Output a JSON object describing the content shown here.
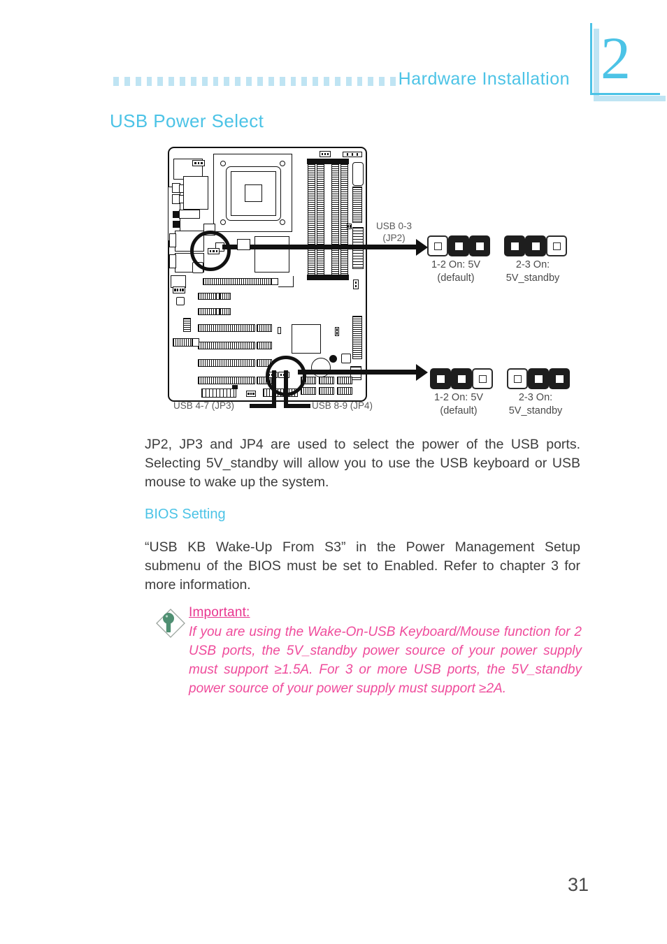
{
  "header": {
    "title": "Hardware  Installation",
    "chapter_number": "2",
    "dot_count": 26,
    "accent_color": "#4cc3e6",
    "dot_color": "#bfe4f3"
  },
  "section": {
    "title": "USB Power Select"
  },
  "diagram": {
    "labels": {
      "jp2_caption_line1": "USB 0-3",
      "jp2_caption_line2": "(JP2)",
      "jp3_caption": "USB 4-7 (JP3)",
      "jp4_caption": "USB 8-9 (JP4)"
    },
    "jumper_sets": [
      {
        "id": "jp2",
        "options": [
          {
            "label_line1": "1-2  On:  5V",
            "label_line2": "(default)",
            "pins": [
              "open",
              "on",
              "on"
            ]
          },
          {
            "label_line1": "2-3  On:",
            "label_line2": "5V_standby",
            "pins": [
              "on",
              "on",
              "open"
            ]
          }
        ]
      },
      {
        "id": "jp3-jp4",
        "options": [
          {
            "label_line1": "1-2  On:  5V",
            "label_line2": "(default)",
            "pins": [
              "on",
              "on",
              "open"
            ]
          },
          {
            "label_line1": "2-3  On:",
            "label_line2": "5V_standby",
            "pins": [
              "open",
              "on",
              "on"
            ]
          }
        ]
      }
    ]
  },
  "body": {
    "paragraph_1": "JP2, JP3 and JP4 are used to select the power of the USB ports. Selecting 5V_standby will allow you to use the USB keyboard or USB mouse to wake up the system.",
    "bios_heading": "BIOS Setting",
    "paragraph_2": "“USB KB Wake-Up From S3” in the Power Management Setup submenu of the BIOS must be set to Enabled. Refer to chapter 3 for more information."
  },
  "note": {
    "icon": "lightbulb-diamond-icon",
    "title": "Important:",
    "text": "If you are using the Wake-On-USB Keyboard/Mouse function for 2 USB ports, the 5V_standby power source of your power supply must support ≥1.5A. For 3 or more USB ports, the 5V_standby power source of your power supply must support ≥2A.",
    "title_color": "#e8368f",
    "text_color": "#ef4b9b",
    "icon_color": "#4f8f72"
  },
  "footer": {
    "page_number": "31"
  }
}
